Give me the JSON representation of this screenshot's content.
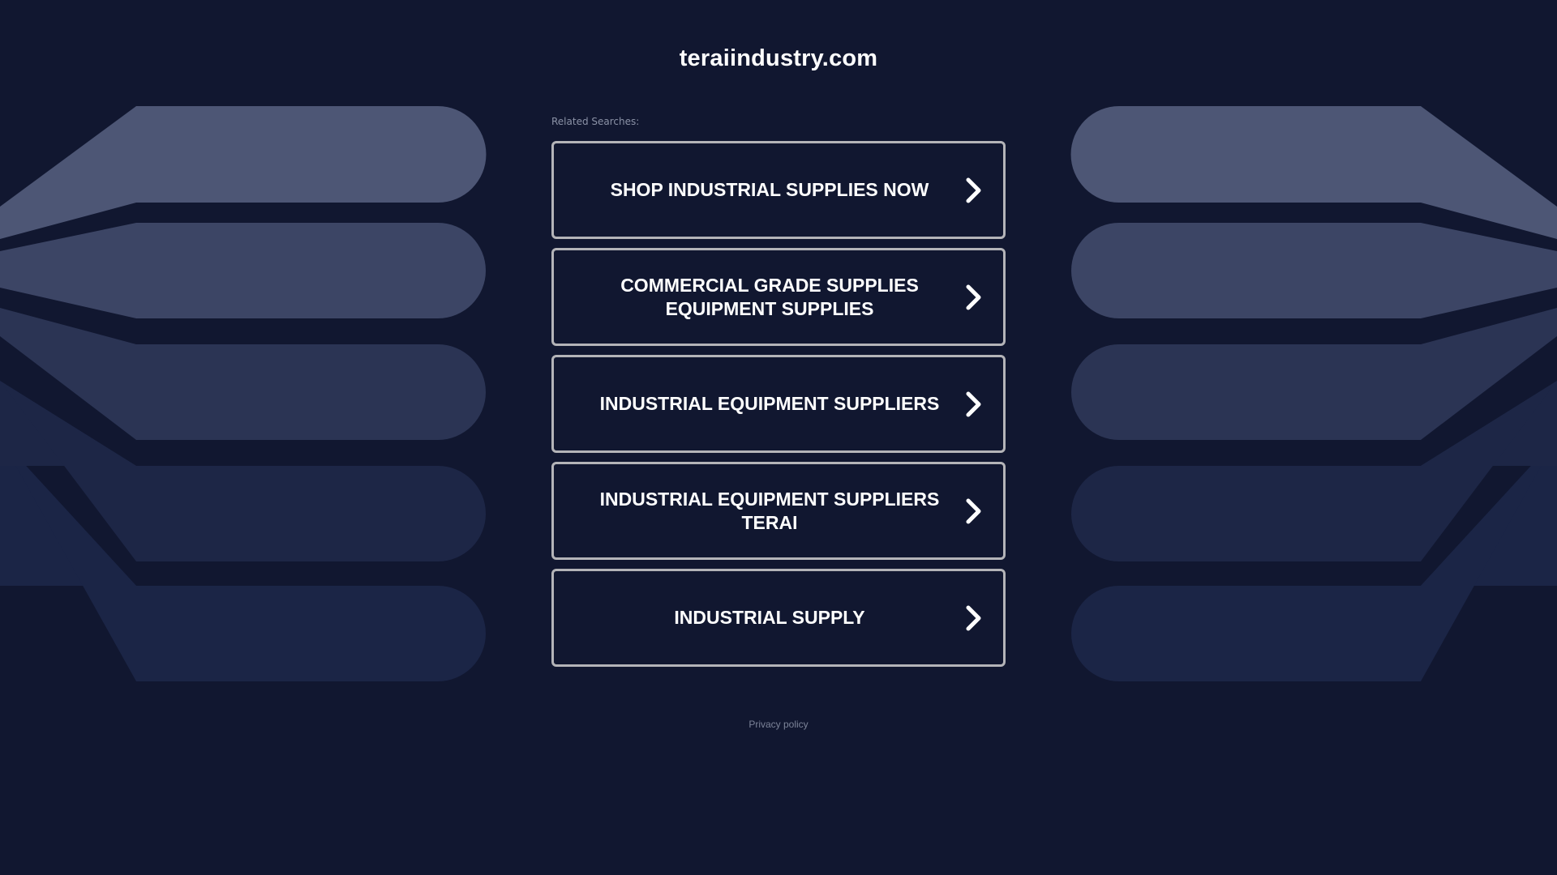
{
  "page": {
    "domain_title": "teraiindustry.com",
    "related_label": "Related Searches:",
    "privacy_label": "Privacy policy"
  },
  "links": [
    {
      "label": "SHOP INDUSTRIAL SUPPLIES NOW",
      "icon": "chevron-right-icon"
    },
    {
      "label": "COMMERCIAL GRADE SUPPLIES EQUIPMENT SUPPLIES",
      "icon": "chevron-right-icon"
    },
    {
      "label": "INDUSTRIAL EQUIPMENT SUPPLIERS",
      "icon": "chevron-right-icon"
    },
    {
      "label": "INDUSTRIAL EQUIPMENT SUPPLIERS TERAI",
      "icon": "chevron-right-icon"
    },
    {
      "label": "INDUSTRIAL SUPPLY",
      "icon": "chevron-right-icon"
    }
  ],
  "colors": {
    "background": "#111730",
    "button_border": "#b4b4b8",
    "text": "#ffffff",
    "muted_text": "#8b92a6",
    "band_1": "#4d5675",
    "band_2": "#3c4565",
    "band_3": "#2b3454",
    "band_4": "#1d2646",
    "band_5": "#1b2546"
  }
}
